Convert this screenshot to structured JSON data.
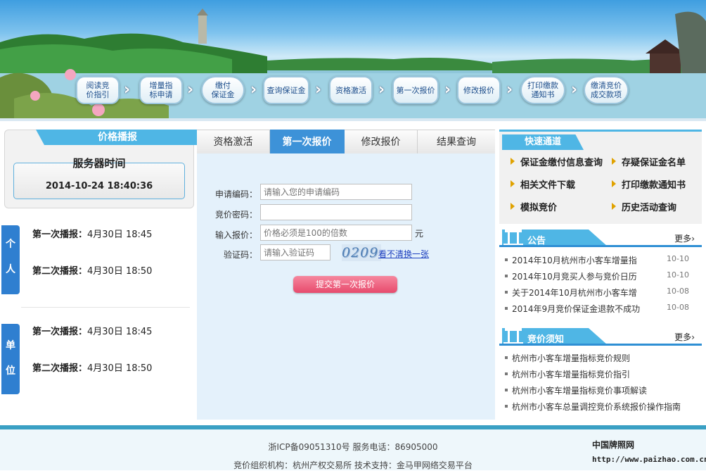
{
  "banner": {
    "steps": [
      {
        "label": "阅读竞\n价指引"
      },
      {
        "label": "增量指\n标申请"
      },
      {
        "label": "缴付\n保证金"
      },
      {
        "label": "查询保证金"
      },
      {
        "label": "资格激活"
      },
      {
        "label": "第一次报价"
      },
      {
        "label": "修改报价"
      },
      {
        "label": "打印缴款\n通知书"
      },
      {
        "label": "缴清竞价\n成交款项"
      }
    ]
  },
  "left": {
    "title": "价格播报",
    "server_time_label": "服务器时间",
    "server_time": "2014-10-24   18:40:36",
    "personal": {
      "tag": "个\n\n人",
      "lines": [
        {
          "label": "第一次播报：",
          "value": "4月30日  18:45"
        },
        {
          "label": "第二次播报：",
          "value": "4月30日  18:50"
        }
      ]
    },
    "company": {
      "tag": "单\n\n位",
      "lines": [
        {
          "label": "第一次播报：",
          "value": "4月30日  18:45"
        },
        {
          "label": "第二次播报：",
          "value": "4月30日  18:50"
        }
      ]
    }
  },
  "center": {
    "tabs": [
      "资格激活",
      "第一次报价",
      "修改报价",
      "结果查询"
    ],
    "active_tab": "第一次报价",
    "form": {
      "apply_code_label": "申请编码：",
      "apply_code_placeholder": "请输入您的申请编码",
      "bid_password_label": "竞价密码：",
      "bid_password_placeholder": "",
      "price_label": "输入报价：",
      "price_placeholder": "价格必须是100的倍数",
      "price_unit": "元",
      "captcha_label": "验证码：",
      "captcha_placeholder": "请输入验证码",
      "captcha_text": "0209",
      "refresh_link": "看不清换一张",
      "submit_label": "提交第一次报价"
    }
  },
  "right": {
    "quick": {
      "title": "快速通道",
      "items": [
        "保证金缴付信息查询",
        "存疑保证金名单",
        "相关文件下载",
        "打印缴款通知书",
        "模拟竞价",
        "历史活动查询"
      ]
    },
    "notice": {
      "title": "公告",
      "more": "更多",
      "items": [
        {
          "text": "2014年10月杭州市小客车增量指",
          "date": "10-10"
        },
        {
          "text": "2014年10月竞买人参与竞价日历",
          "date": "10-10"
        },
        {
          "text": "关于2014年10月杭州市小客车增",
          "date": "10-08"
        },
        {
          "text": "2014年9月竞价保证金退款不成功",
          "date": "10-08"
        }
      ]
    },
    "guide": {
      "title": "竞价须知",
      "more": "更多",
      "items": [
        "杭州市小客车增量指标竞价规则",
        "杭州市小客车增量指标竞价指引",
        "杭州市小客车增量指标竞价事项解读",
        "杭州市小客车总量调控竞价系统报价操作指南"
      ]
    }
  },
  "footer": {
    "line1": "浙ICP备09051310号        服务电话：86905000",
    "line2": "竞价组织机构：杭州产权交易所  技术支持：金马甲网络交易平台",
    "watermark1": "中国牌照网",
    "watermark2": "http://www.paizhao.com.cn"
  }
}
